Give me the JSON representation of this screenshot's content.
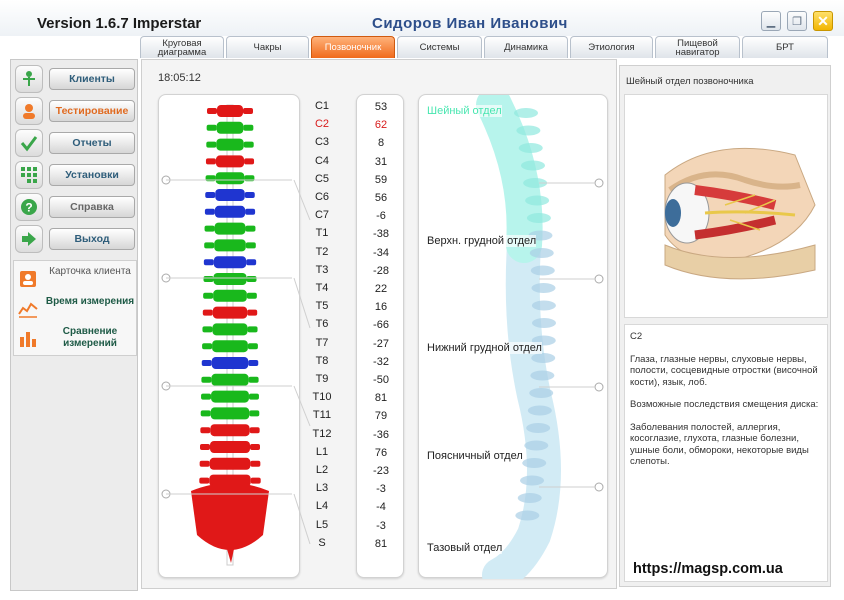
{
  "window": {
    "title": "Version 1.6.7 Imperstar",
    "user": "Сидоров  Иван  Иванович",
    "controls": {
      "minimize": "▁",
      "maximize": "❐",
      "close": "✕"
    }
  },
  "tabs": [
    {
      "label": "Круговая диаграмма",
      "width": 84
    },
    {
      "label": "Чакры",
      "width": 83
    },
    {
      "label": "Позвоночник",
      "width": 84,
      "active": true
    },
    {
      "label": "Системы",
      "width": 85
    },
    {
      "label": "Динамика",
      "width": 84
    },
    {
      "label": "Этиология",
      "width": 83
    },
    {
      "label": "Пищевой навигатор",
      "width": 85
    },
    {
      "label": "БРТ",
      "width": 86
    }
  ],
  "sidebar": {
    "nav": [
      {
        "label": "Клиенты",
        "icon": "person-icon"
      },
      {
        "label": "Тестирование",
        "icon": "user-icon",
        "current": true
      },
      {
        "label": "Отчеты",
        "icon": "check-icon"
      },
      {
        "label": "Установки",
        "icon": "grid-icon"
      },
      {
        "label": "Справка",
        "icon": "help-icon",
        "dim": true
      },
      {
        "label": "Выход",
        "icon": "exit-arrow-icon"
      }
    ],
    "sub": [
      {
        "label": "Карточка клиента",
        "icon": "client-card-icon",
        "dim": true
      },
      {
        "label": "Время измерения",
        "icon": "measure-time-icon"
      },
      {
        "label": "Сравнение измерений",
        "icon": "compare-icon"
      }
    ]
  },
  "main": {
    "clock": "18:05:12",
    "selected": "C2",
    "vertebrae": [
      {
        "label": "C1",
        "value": "53"
      },
      {
        "label": "C2",
        "value": "62"
      },
      {
        "label": "C3",
        "value": "8"
      },
      {
        "label": "C4",
        "value": "31"
      },
      {
        "label": "C5",
        "value": "59"
      },
      {
        "label": "C6",
        "value": "56"
      },
      {
        "label": "C7",
        "value": "-6"
      },
      {
        "label": "T1",
        "value": "-38"
      },
      {
        "label": "T2",
        "value": "-34"
      },
      {
        "label": "T3",
        "value": "-28"
      },
      {
        "label": "T4",
        "value": "22"
      },
      {
        "label": "T5",
        "value": "16"
      },
      {
        "label": "T6",
        "value": "-66"
      },
      {
        "label": "T7",
        "value": "-27"
      },
      {
        "label": "T8",
        "value": "-32"
      },
      {
        "label": "T9",
        "value": "-50"
      },
      {
        "label": "T10",
        "value": "81"
      },
      {
        "label": "T11",
        "value": "79"
      },
      {
        "label": "T12",
        "value": "-36"
      },
      {
        "label": "L1",
        "value": "76"
      },
      {
        "label": "L2",
        "value": "-23"
      },
      {
        "label": "L3",
        "value": "-3"
      },
      {
        "label": "L4",
        "value": "-4"
      },
      {
        "label": "L5",
        "value": "-3"
      },
      {
        "label": "S",
        "value": "81"
      }
    ],
    "sections": [
      {
        "label": "Шейный отдел",
        "active": true
      },
      {
        "label": "Верхн. грудной отдел"
      },
      {
        "label": "Нижний грудной отдел"
      },
      {
        "label": "Поясничный отдел"
      },
      {
        "label": "Тазовый отдел"
      }
    ]
  },
  "info": {
    "title": "Шейный отдел позвоночника",
    "code": "C2",
    "organs": "Глаза, глазные нервы, слуховые нервы, полости, сосцевидные отростки (височной кости), язык, лоб.",
    "consequences_title": "Возможные последствия смещения диска:",
    "consequences": "Заболевания полостей, аллергия, косоглазие, глухота, глазные болезни, ушные боли, обмороки, некоторые виды слепоты."
  },
  "watermark": "https://magsp.com.ua",
  "colors": {
    "red": "#e01818",
    "green": "#19b81c",
    "blue": "#1f35d0",
    "accent": "#f06a1c",
    "cyan": "#48e6b0"
  }
}
